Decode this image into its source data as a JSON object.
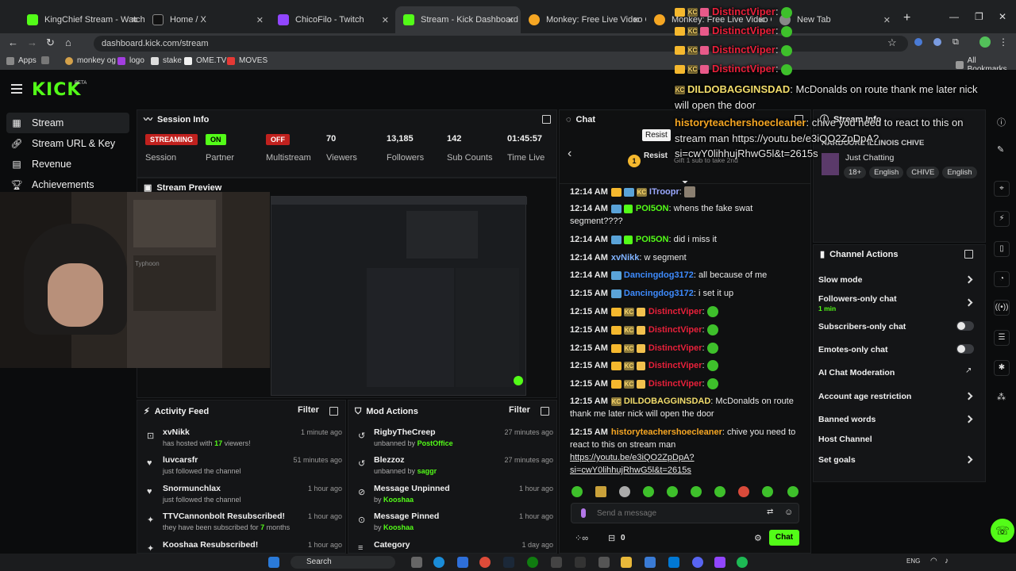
{
  "browser": {
    "tabs": [
      {
        "title": "KingChief Stream - Watch Live"
      },
      {
        "title": "Home / X"
      },
      {
        "title": "ChicoFilo - Twitch"
      },
      {
        "title": "Stream - Kick Dashboard"
      },
      {
        "title": "Monkey: Free Live Video C"
      },
      {
        "title": "Monkey: Free Live Video C"
      },
      {
        "title": "New Tab"
      }
    ],
    "url": "dashboard.kick.com/stream",
    "bookmarks": [
      "Apps",
      "monkey og",
      "logo",
      "stake",
      "OME.TV",
      "MOVES"
    ],
    "all_bookmarks": "All Bookmarks"
  },
  "brand": {
    "logo": "KICK",
    "beta": "BETA"
  },
  "sidebar": {
    "items": [
      {
        "label": "Stream"
      },
      {
        "label": "Stream URL & Key"
      },
      {
        "label": "Revenue"
      },
      {
        "label": "Achievements"
      }
    ]
  },
  "session": {
    "title": "Session Info",
    "stats": [
      {
        "value": "STREAMING",
        "label": "Session"
      },
      {
        "value": "ON",
        "label": "Partner Income"
      },
      {
        "value": "OFF",
        "label": "Multistream"
      },
      {
        "value": "70",
        "label": "Viewers"
      },
      {
        "value": "13,185",
        "label": "Followers"
      },
      {
        "value": "142",
        "label": "Sub Counts"
      },
      {
        "value": "01:45:57",
        "label": "Time Live"
      }
    ]
  },
  "preview": {
    "title": "Stream Preview",
    "webcam_text": "Typhoon"
  },
  "activity": {
    "title": "Activity Feed",
    "filter": "Filter",
    "items": [
      {
        "name": "xvNikk",
        "desc_pre": "has hosted with",
        "desc_num": "17",
        "desc_post": "viewers!",
        "time": "1 minute ago"
      },
      {
        "name": "luvcarsfr",
        "desc": "just followed the channel",
        "time": "51 minutes ago"
      },
      {
        "name": "Snormunchlax",
        "desc": "just followed the channel",
        "time": "1 hour ago"
      },
      {
        "name": "TTVCannonbolt Resubscribed!",
        "desc_pre": "they have been subscribed for",
        "desc_num": "7",
        "desc_post": "months",
        "time": "1 hour ago"
      },
      {
        "name": "Kooshaa Resubscribed!",
        "desc": "",
        "time": "1 hour ago"
      }
    ]
  },
  "mod": {
    "title": "Mod Actions",
    "filter": "Filter",
    "items": [
      {
        "name": "RigbyTheCreep",
        "desc": "unbanned by",
        "by": "PostOffice",
        "time": "27 minutes ago"
      },
      {
        "name": "Blezzoz",
        "desc": "unbanned by",
        "by": "saggr",
        "time": "27 minutes ago"
      },
      {
        "name": "Message Unpinned",
        "desc": "by",
        "by": "Kooshaa",
        "time": "1 hour ago"
      },
      {
        "name": "Message Pinned",
        "desc": "by",
        "by": "Kooshaa",
        "time": "1 hour ago"
      },
      {
        "name": "Category",
        "desc": "",
        "by": "",
        "time": "1 day ago"
      }
    ]
  },
  "chat": {
    "title": "Chat",
    "pinned_user": "Resist",
    "pinned_tooltip": "Resist",
    "gift_text": "Gift 1 sub to take 2nd",
    "messages": [
      {
        "time": "12:14 AM",
        "user": "ITroopr",
        "text": ""
      },
      {
        "time": "12:14 AM",
        "user": "POI5ON",
        "text": "whens the fake swat"
      },
      {
        "time": "",
        "user": "",
        "text": "segment????"
      },
      {
        "time": "12:14 AM",
        "user": "POI5ON",
        "text": "did i miss it"
      },
      {
        "time": "12:14 AM",
        "user": "xvNikk",
        "text": "w segment"
      },
      {
        "time": "12:14 AM",
        "user": "Dancingdog3172",
        "text": "all because of me"
      },
      {
        "time": "12:15 AM",
        "user": "Dancingdog3172",
        "text": "i set it up"
      },
      {
        "time": "12:15 AM",
        "user": "DistinctViper",
        "text": ""
      },
      {
        "time": "12:15 AM",
        "user": "DistinctViper",
        "text": ""
      },
      {
        "time": "12:15 AM",
        "user": "DistinctViper",
        "text": ""
      },
      {
        "time": "12:15 AM",
        "user": "DistinctViper",
        "text": ""
      },
      {
        "time": "12:15 AM",
        "user": "DistinctViper",
        "text": ""
      },
      {
        "time": "12:15 AM",
        "user": "DILDOBAGGINSDAD",
        "text": "McDonalds on route"
      },
      {
        "time": "",
        "user": "",
        "text": "thank me later nick will open the door"
      },
      {
        "time": "12:15 AM",
        "user": "historyteachershoecleaner",
        "text": "chive you need to"
      },
      {
        "time": "",
        "user": "",
        "text": "react to this on stream man"
      },
      {
        "time": "",
        "user": "",
        "text": "https://youtu.be/e3iQO2ZpDpA?"
      },
      {
        "time": "",
        "user": "",
        "text": "si=cwY0lihhujRhwG5l&t=2615s"
      }
    ],
    "input_placeholder": "Send a message",
    "points": "0",
    "send_label": "Chat"
  },
  "stream_info": {
    "title": "Stream Info",
    "stream_title": "HARDCORE ILLINOIS CHIVE",
    "category": "Just Chatting",
    "tags": [
      "18+",
      "English",
      "CHIVE",
      "English"
    ]
  },
  "channel_actions": {
    "title": "Channel Actions",
    "items": [
      {
        "label": "Slow mode",
        "sub": "",
        "control": "chevron"
      },
      {
        "label": "Followers-only chat",
        "sub": "1 min",
        "control": "chevron"
      },
      {
        "label": "Subscribers-only chat",
        "sub": "",
        "control": "toggle"
      },
      {
        "label": "Emotes-only chat",
        "sub": "",
        "control": "toggle"
      },
      {
        "label": "AI Chat Moderation",
        "sub": "",
        "control": "external"
      },
      {
        "label": "Account age restriction",
        "sub": "",
        "control": "chevron"
      },
      {
        "label": "Banned words",
        "sub": "",
        "control": "chevron"
      },
      {
        "label": "Host Channel",
        "sub": "",
        "control": "none"
      },
      {
        "label": "Set goals",
        "sub": "",
        "control": "chevron"
      }
    ]
  },
  "overlay": {
    "lines": [
      {
        "user": "DistinctViper",
        "text": ""
      },
      {
        "user": "DistinctViper",
        "text": ""
      },
      {
        "user": "DistinctViper",
        "text": ""
      },
      {
        "user": "DistinctViper",
        "text": ""
      },
      {
        "user": "DILDOBAGGINSDAD",
        "text": ": McDonalds on route thank me later nick"
      },
      {
        "user": "",
        "text": "will open the door"
      },
      {
        "user": "historyteachershoecleaner",
        "text": ": chive you need to react to this on"
      },
      {
        "user": "",
        "text": "stream man https://youtu.be/e3iQO2ZpDpA?"
      },
      {
        "user": "",
        "text": "si=cwY0lihhujRhwG5l&t=2615s"
      }
    ]
  },
  "taskbar": {
    "search": "Search",
    "lang": "ENG"
  },
  "colors": {
    "accent": "#53fc18",
    "red": "#eb0400",
    "orange": "#f5a623",
    "bg": "#0b0c0d"
  }
}
